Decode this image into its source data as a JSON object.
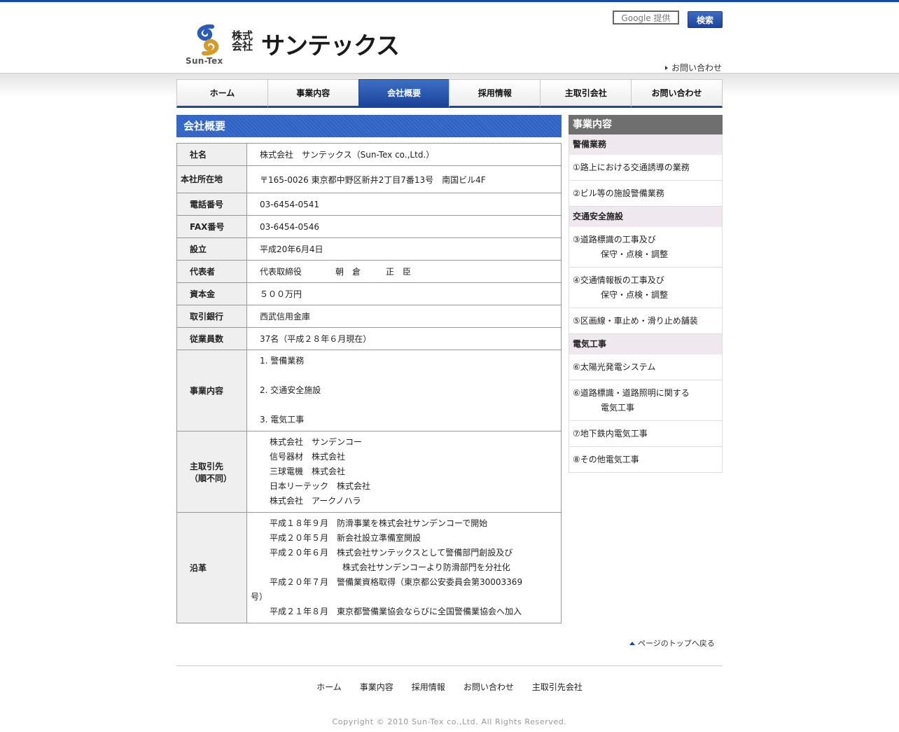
{
  "header": {
    "logo_en": "Sun-Tex",
    "logo_small": "株式会社",
    "logo_big": "サンテックス",
    "search_placeholder": "Google 提供",
    "search_button": "検索",
    "contact_link": "お問い合わせ"
  },
  "nav": {
    "items": [
      {
        "label": "ホーム"
      },
      {
        "label": "事業内容"
      },
      {
        "label": "会社概要",
        "active": true
      },
      {
        "label": "採用情報"
      },
      {
        "label": "主取引会社"
      },
      {
        "label": "お問い合わせ"
      }
    ]
  },
  "section_title": "会社概要",
  "company": {
    "name_label": "社名",
    "name_value": "株式会社　サンテックス（Sun-Tex co.,Ltd.）",
    "address_label": "本社所在地",
    "address_value": "〒165-0026 東京都中野区新井2丁目7番13号　南国ビル4F",
    "tel_label": "電話番号",
    "tel_value": "03-6454-0541",
    "fax_label": "FAX番号",
    "fax_value": "03-6454-0546",
    "founded_label": "設立",
    "founded_value": "平成20年6月4日",
    "rep_label": "代表者",
    "rep_value": "代表取締役　　　　朝　倉　　　正　臣",
    "capital_label": "資本金",
    "capital_value": "５００万円",
    "bank_label": "取引銀行",
    "bank_value": "西武信用金庫",
    "staff_label": "従業員数",
    "staff_value": "37名（平成２８年６月現在）",
    "business_label": "事業内容",
    "business_items": [
      "1. 警備業務",
      "2. 交通安全施設",
      "3. 電気工事"
    ],
    "clients_label_1": "主取引先",
    "clients_label_2": "（順不同）",
    "clients": [
      "株式会社　サンデンコー",
      "信号器材　株式会社",
      "三球電機　株式会社",
      "日本リーテック　株式会社",
      "株式会社　アークノハラ"
    ],
    "history_label": "沿革",
    "history": [
      "平成１８年９月　防滑事業を株式会社サンデンコーで開始",
      "平成２０年５月　新会社設立準備室開設",
      "平成２０年６月　株式会社サンテックスとして警備部門創設及び",
      "株式会社サンデンコーより防滑部門を分社化",
      "平成２０年７月　警備業資格取得（東京都公安委員会第30003369",
      "号）",
      "平成２１年８月　東京都警備業協会ならびに全国警備業協会へ加入"
    ]
  },
  "sidebar": {
    "title": "事業内容",
    "cat1": "警備業務",
    "item1": "①路上における交通誘導の業務",
    "item2": "②ビル等の施設警備業務",
    "cat2": "交通安全施設",
    "item3a": "③道路標識の工事及び",
    "item3b": "保守・点検・調整",
    "item4a": "④交通情報板の工事及び",
    "item4b": "保守・点検・調整",
    "item5": "⑤区画線・車止め・滑り止め舗装",
    "cat3": "電気工事",
    "item6": "⑥太陽光発電システム",
    "item7a": "⑥道路標識・道路照明に関する",
    "item7b": "電気工事",
    "item8": "⑦地下鉄内電気工事",
    "item9": "⑧その他電気工事"
  },
  "pagetop": "ページのトップへ戻る",
  "footer": {
    "links": [
      "ホーム",
      "事業内容",
      "採用情報",
      "お問い合わせ",
      "主取引先会社"
    ],
    "copyright": "Copyright © 2010 Sun-Tex co.,Ltd. All Rights Reserved."
  },
  "colors": {
    "brand_blue": "#1a4a9a",
    "section_blue": "#2c62c4",
    "sidebar_head": "#6f6f6f",
    "sidebar_cat": "#efe8ee"
  }
}
